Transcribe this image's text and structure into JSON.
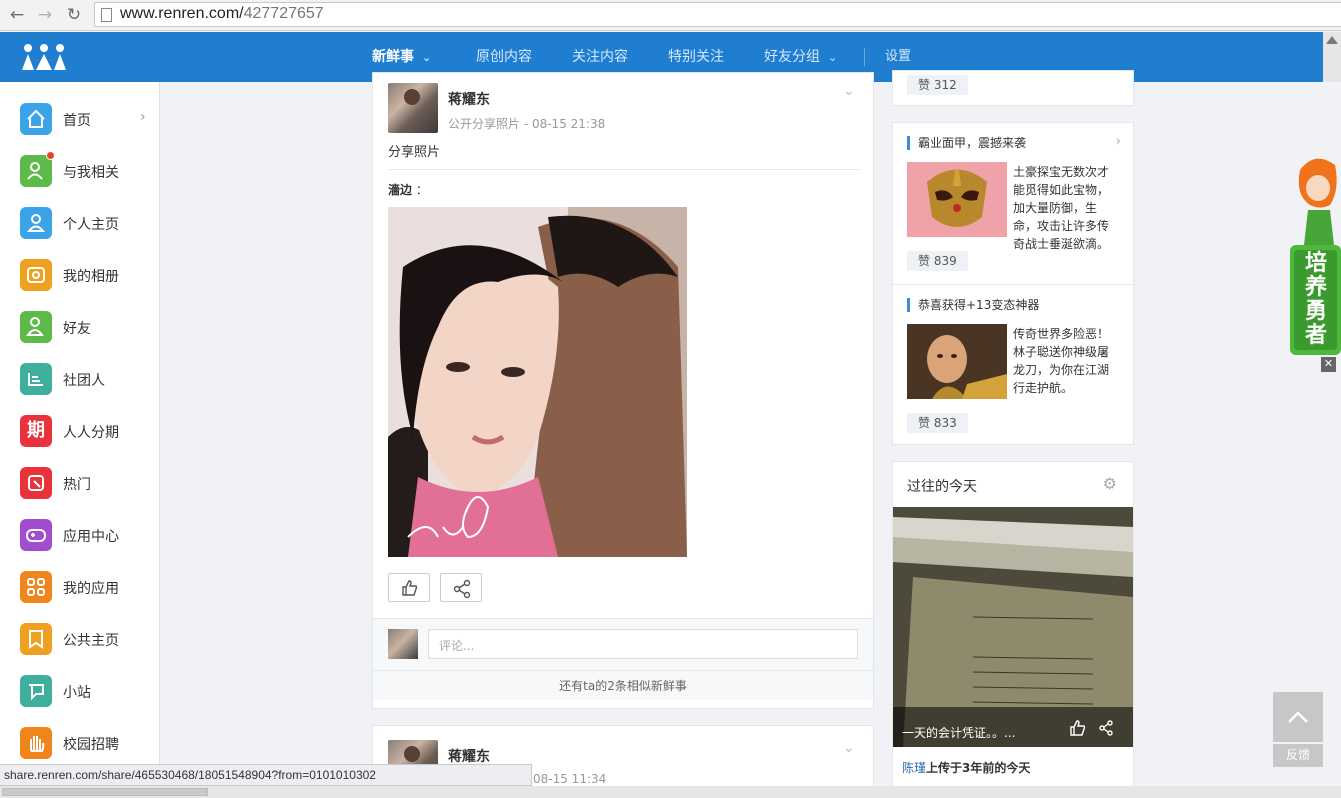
{
  "browser": {
    "url_host": "www.renren.com/",
    "url_path": "427727657"
  },
  "topnav": {
    "items": [
      {
        "label": "新鲜事"
      },
      {
        "label": "原创内容"
      },
      {
        "label": "关注内容"
      },
      {
        "label": "特别关注"
      },
      {
        "label": "好友分组"
      },
      {
        "label": "设置"
      }
    ]
  },
  "sidebar": {
    "items": [
      {
        "label": "首页",
        "icon": "home-icon",
        "color": "#3ba3e8"
      },
      {
        "label": "与我相关",
        "icon": "person-bell-icon",
        "color": "#5cba48"
      },
      {
        "label": "个人主页",
        "icon": "person-icon",
        "color": "#3ba3e8"
      },
      {
        "label": "我的相册",
        "icon": "album-icon",
        "color": "#f0a020"
      },
      {
        "label": "好友",
        "icon": "friends-icon",
        "color": "#5cba48"
      },
      {
        "label": "社团人",
        "icon": "club-icon",
        "color": "#3fae9c"
      },
      {
        "label": "人人分期",
        "icon": "installment-icon",
        "color": "#e8323c",
        "glyph": "期"
      },
      {
        "label": "热门",
        "icon": "hot-icon",
        "color": "#e8323c"
      },
      {
        "label": "应用中心",
        "icon": "gamepad-icon",
        "color": "#a24dcf"
      },
      {
        "label": "我的应用",
        "icon": "apps-grid-icon",
        "color": "#f0851c"
      },
      {
        "label": "公共主页",
        "icon": "bookmark-icon",
        "color": "#f0a020"
      },
      {
        "label": "小站",
        "icon": "station-icon",
        "color": "#3fae9c"
      },
      {
        "label": "校园招聘",
        "icon": "hand-icon",
        "color": "#f0851c"
      }
    ]
  },
  "feed": {
    "post1": {
      "author": "蒋耀东",
      "meta": "公开分享照片 - 08-15 21:38",
      "text": "分享照片",
      "source_name": "濇边",
      "source_suffix": "：",
      "comment_placeholder": "评论...",
      "more_similar": "还有ta的2条相似新鲜事"
    },
    "post2": {
      "author": "蒋耀东",
      "meta": "08-15 11:34"
    }
  },
  "right": {
    "top_like": "赞 312",
    "ad1": {
      "title": "霸业面甲，震撼来袭",
      "text": "土豪探宝无数次才能觅得如此宝物，加大量防御，生命，攻击让许多传奇战士垂涎欲滴。",
      "like": "赞 839"
    },
    "ad2": {
      "title": "恭喜获得+13变态神器",
      "text": "传奇世界多险恶！林子聪送你神级屠龙刀，为你在江湖行走护航。",
      "like": "赞 833"
    },
    "past_today": {
      "title": "过往的今天",
      "caption": "一天的会计凭证。。...",
      "who": "陈瑾",
      "footer_text": "上传于3年前的今天"
    }
  },
  "widgets": {
    "mascot_text": "培养勇者",
    "feedback": "反馈",
    "close": "✕"
  },
  "statusbar": {
    "text": "share.renren.com/share/465530468/18051548904?from=0101010302"
  }
}
